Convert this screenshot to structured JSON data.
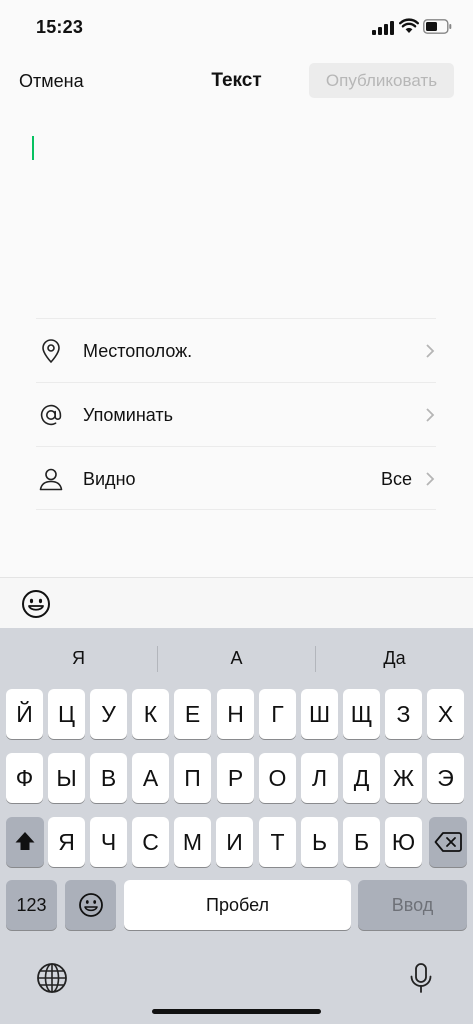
{
  "status_bar": {
    "time": "15:23"
  },
  "nav": {
    "cancel": "Отмена",
    "title": "Текст",
    "publish": "Опубликовать"
  },
  "options": [
    {
      "label": "Местополож.",
      "value": "",
      "icon": "location-pin-icon"
    },
    {
      "label": "Упоминать",
      "value": "",
      "icon": "at-sign-icon"
    },
    {
      "label": "Видно",
      "value": "Все",
      "icon": "person-icon"
    }
  ],
  "keyboard": {
    "suggestions": [
      "Я",
      "А",
      "Да"
    ],
    "row1": [
      "Й",
      "Ц",
      "У",
      "К",
      "Е",
      "Н",
      "Г",
      "Ш",
      "Щ",
      "З",
      "Х"
    ],
    "row2": [
      "Ф",
      "Ы",
      "В",
      "А",
      "П",
      "Р",
      "О",
      "Л",
      "Д",
      "Ж",
      "Э"
    ],
    "row3": [
      "Я",
      "Ч",
      "С",
      "М",
      "И",
      "Т",
      "Ь",
      "Б",
      "Ю"
    ],
    "numbers": "123",
    "space": "Пробел",
    "enter": "Ввод"
  },
  "colors": {
    "accent_caret": "#07c160",
    "keyboard_bg": "#d2d5db",
    "publish_disabled_text": "#b7b7b7"
  }
}
